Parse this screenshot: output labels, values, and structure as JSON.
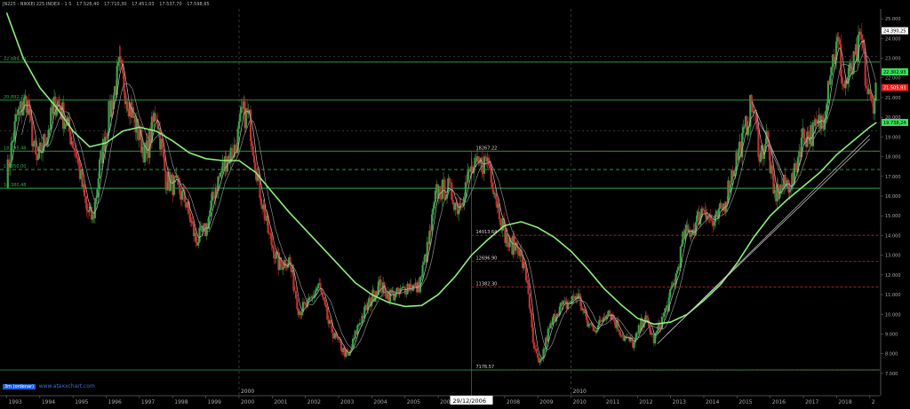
{
  "header": {
    "symbol": "JN225 - NIKKEI 225 INDEX - 1 S",
    "readout": [
      "17.526,40",
      "17.710,30",
      "17.451,03",
      "17.537,70",
      "17.598,65"
    ]
  },
  "footer": {
    "badge": "3m (ordenar)",
    "watermark": "www.ataxxchart.com"
  },
  "chart_data": {
    "type": "candlestick",
    "x_axis": {
      "years": [
        "1993",
        "1994",
        "1995",
        "1996",
        "1997",
        "1998",
        "1999",
        "2000",
        "2001",
        "2002",
        "2003",
        "2004",
        "2005",
        "2006",
        "2007",
        "2008",
        "2009",
        "2010",
        "2011",
        "2012",
        "2013",
        "2014",
        "2015",
        "2016",
        "2017",
        "2018",
        "2"
      ],
      "decade_labels": [
        "2000",
        "2010"
      ],
      "cursor_date": "29/12/2006"
    },
    "y_axis": {
      "min": 6500,
      "max": 25500,
      "ticks": [
        "7.000",
        "8.000",
        "9.000",
        "10.000",
        "11.000",
        "12.000",
        "13.000",
        "14.000",
        "15.000",
        "16.000",
        "17.000",
        "18.000",
        "19.000",
        "20.000",
        "21.000",
        "22.000",
        "23.000",
        "24.000",
        "25.000"
      ]
    },
    "price_badges": [
      {
        "label": "24.390,25",
        "value": 24390,
        "bg": "#ffffff",
        "fg": "#000000"
      },
      {
        "label": "22.302,93",
        "value": 22303,
        "bg": "#39e05a",
        "fg": "#000000"
      },
      {
        "label": "21.505,93",
        "value": 21506,
        "bg": "#e02020",
        "fg": "#ffffff"
      },
      {
        "label": "19.738,24",
        "value": 19738,
        "bg": "#39e05a",
        "fg": "#000000"
      }
    ],
    "green_levels": [
      {
        "value": 22800,
        "label": "22.689,34"
      },
      {
        "value": 20870,
        "label": "20.892,28"
      },
      {
        "value": 18280,
        "label": "18.295,48"
      },
      {
        "value": 17350,
        "label": "17.350,00"
      },
      {
        "value": 16400,
        "label": "16.380,48"
      }
    ],
    "red_levels": [
      {
        "value": 18267,
        "label": "18267.22",
        "from": 2007.0
      },
      {
        "value": 14010,
        "label": "14013.64",
        "from": 2007.0
      },
      {
        "value": 12696,
        "label": "12696.90",
        "from": 2007.0
      },
      {
        "value": 11382,
        "label": "11382.30",
        "from": 2007.0
      },
      {
        "value": 7176,
        "label": "7176.57",
        "from": 2007.0
      }
    ],
    "close": [
      [
        1993.0,
        17000
      ],
      [
        1993.3,
        20000
      ],
      [
        1993.6,
        20900
      ],
      [
        1993.9,
        17600
      ],
      [
        1994.2,
        19100
      ],
      [
        1994.5,
        20900
      ],
      [
        1994.8,
        19700
      ],
      [
        1995.1,
        18200
      ],
      [
        1995.4,
        15300
      ],
      [
        1995.6,
        14800
      ],
      [
        1995.8,
        17500
      ],
      [
        1996.1,
        20300
      ],
      [
        1996.4,
        22500
      ],
      [
        1996.6,
        21200
      ],
      [
        1996.9,
        19500
      ],
      [
        1997.2,
        18000
      ],
      [
        1997.5,
        20400
      ],
      [
        1997.8,
        16800
      ],
      [
        1998.1,
        16500
      ],
      [
        1998.4,
        15700
      ],
      [
        1998.7,
        13700
      ],
      [
        1999.0,
        14300
      ],
      [
        1999.3,
        16500
      ],
      [
        1999.6,
        17800
      ],
      [
        1999.9,
        18500
      ],
      [
        2000.1,
        20200
      ],
      [
        2000.3,
        20000
      ],
      [
        2000.6,
        16500
      ],
      [
        2000.9,
        14000
      ],
      [
        2001.2,
        12500
      ],
      [
        2001.5,
        12800
      ],
      [
        2001.8,
        10200
      ],
      [
        2002.1,
        10500
      ],
      [
        2002.4,
        11500
      ],
      [
        2002.7,
        9500
      ],
      [
        2003.0,
        8500
      ],
      [
        2003.3,
        7800
      ],
      [
        2003.6,
        9500
      ],
      [
        2003.9,
        10500
      ],
      [
        2004.2,
        11500
      ],
      [
        2004.5,
        11000
      ],
      [
        2004.8,
        11000
      ],
      [
        2005.1,
        11500
      ],
      [
        2005.4,
        11300
      ],
      [
        2005.7,
        13500
      ],
      [
        2005.95,
        16200
      ],
      [
        2006.3,
        16400
      ],
      [
        2006.6,
        15400
      ],
      [
        2006.95,
        17200
      ],
      [
        2007.3,
        17600
      ],
      [
        2007.5,
        17900
      ],
      [
        2007.8,
        15500
      ],
      [
        2008.1,
        13500
      ],
      [
        2008.4,
        13500
      ],
      [
        2008.7,
        11500
      ],
      [
        2008.85,
        8500
      ],
      [
        2009.05,
        7300
      ],
      [
        2009.3,
        9000
      ],
      [
        2009.6,
        10300
      ],
      [
        2009.9,
        10500
      ],
      [
        2010.2,
        11000
      ],
      [
        2010.5,
        9500
      ],
      [
        2010.8,
        9300
      ],
      [
        2011.1,
        10300
      ],
      [
        2011.3,
        9700
      ],
      [
        2011.6,
        8800
      ],
      [
        2011.9,
        8500
      ],
      [
        2012.2,
        9900
      ],
      [
        2012.5,
        8700
      ],
      [
        2012.9,
        10400
      ],
      [
        2013.2,
        12200
      ],
      [
        2013.4,
        14000
      ],
      [
        2013.7,
        14400
      ],
      [
        2014.0,
        15500
      ],
      [
        2014.3,
        14500
      ],
      [
        2014.6,
        15500
      ],
      [
        2014.9,
        17500
      ],
      [
        2015.2,
        19000
      ],
      [
        2015.45,
        20800
      ],
      [
        2015.7,
        18000
      ],
      [
        2015.9,
        19000
      ],
      [
        2016.1,
        16000
      ],
      [
        2016.4,
        16500
      ],
      [
        2016.7,
        16800
      ],
      [
        2016.95,
        19000
      ],
      [
        2017.3,
        19200
      ],
      [
        2017.6,
        20000
      ],
      [
        2017.8,
        22500
      ],
      [
        2018.05,
        23800
      ],
      [
        2018.2,
        21500
      ],
      [
        2018.5,
        22500
      ],
      [
        2018.75,
        24000
      ],
      [
        2018.9,
        21500
      ],
      [
        2019.05,
        20500
      ],
      [
        2019.2,
        21500
      ]
    ],
    "moving_average_slow": [
      [
        1993.0,
        25300
      ],
      [
        1993.5,
        23000
      ],
      [
        1994.0,
        21500
      ],
      [
        1994.5,
        20500
      ],
      [
        1995.0,
        19300
      ],
      [
        1995.5,
        18500
      ],
      [
        1996.0,
        18700
      ],
      [
        1996.5,
        19300
      ],
      [
        1997.0,
        19500
      ],
      [
        1997.5,
        19300
      ],
      [
        1998.0,
        18800
      ],
      [
        1998.5,
        18200
      ],
      [
        1999.0,
        17900
      ],
      [
        1999.5,
        17800
      ],
      [
        2000.0,
        17800
      ],
      [
        2000.5,
        17200
      ],
      [
        2001.0,
        16200
      ],
      [
        2001.5,
        15200
      ],
      [
        2002.0,
        14300
      ],
      [
        2002.5,
        13400
      ],
      [
        2003.0,
        12500
      ],
      [
        2003.5,
        11600
      ],
      [
        2004.0,
        11000
      ],
      [
        2004.5,
        10600
      ],
      [
        2005.0,
        10400
      ],
      [
        2005.5,
        10450
      ],
      [
        2006.0,
        11000
      ],
      [
        2006.5,
        11900
      ],
      [
        2007.0,
        13000
      ],
      [
        2007.5,
        13800
      ],
      [
        2008.0,
        14500
      ],
      [
        2008.5,
        14700
      ],
      [
        2009.0,
        14400
      ],
      [
        2009.5,
        13900
      ],
      [
        2010.0,
        13200
      ],
      [
        2010.5,
        12300
      ],
      [
        2011.0,
        11300
      ],
      [
        2011.5,
        10500
      ],
      [
        2012.0,
        9800
      ],
      [
        2012.5,
        9500
      ],
      [
        2013.0,
        9600
      ],
      [
        2013.5,
        10000
      ],
      [
        2014.0,
        10700
      ],
      [
        2014.5,
        11500
      ],
      [
        2015.0,
        12600
      ],
      [
        2015.5,
        13900
      ],
      [
        2016.0,
        15000
      ],
      [
        2016.5,
        15800
      ],
      [
        2017.0,
        16500
      ],
      [
        2017.5,
        17200
      ],
      [
        2018.0,
        18100
      ],
      [
        2018.5,
        18800
      ],
      [
        2019.0,
        19500
      ],
      [
        2019.2,
        19738
      ]
    ],
    "trend_lines": [
      {
        "from": [
          2012.6,
          8500
        ],
        "to": [
          2019.0,
          19100
        ]
      },
      {
        "from": [
          2012.9,
          9000
        ],
        "to": [
          2019.0,
          18900
        ]
      },
      {
        "from": [
          2015.45,
          20800
        ],
        "to": [
          2016.4,
          17000
        ]
      }
    ]
  }
}
